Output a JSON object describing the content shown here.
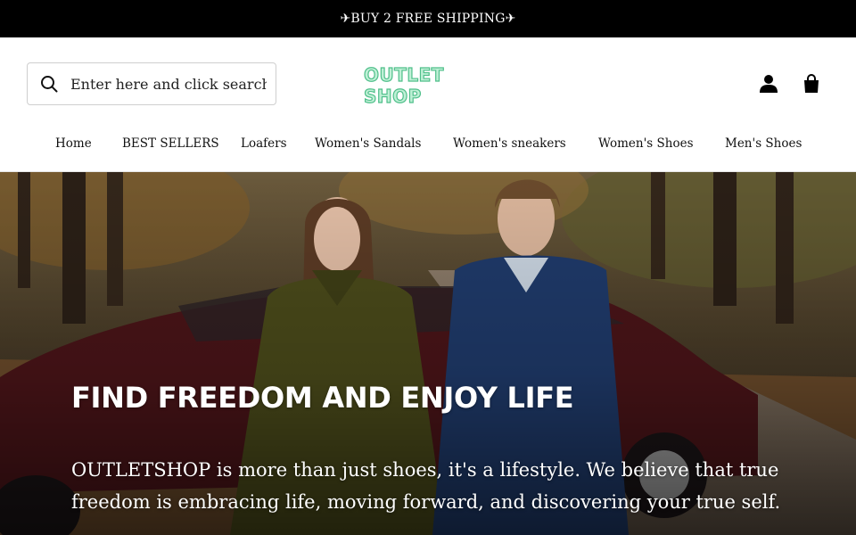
{
  "announcement": {
    "text": "✈BUY 2 FREE SHIPPING✈"
  },
  "search": {
    "placeholder": "Enter here and click search"
  },
  "logo": {
    "text": "OUTLET SHOP",
    "fill_color": "#bff0d6",
    "outline_color": "#4fbf8a"
  },
  "header_icons": {
    "account": "user-icon",
    "cart": "shopping-bag-icon"
  },
  "nav": {
    "items": [
      {
        "label": "Home"
      },
      {
        "label": "BEST SELLERS"
      },
      {
        "label": "Loafers"
      },
      {
        "label": "Women's Sandals"
      },
      {
        "label": "Women's sneakers"
      },
      {
        "label": "Women's Shoes"
      },
      {
        "label": "Men's Shoes"
      }
    ]
  },
  "hero": {
    "title": "FIND FREEDOM AND ENJOY LIFE",
    "body": "OUTLETSHOP is more than just shoes, it's a lifestyle. We believe that true freedom is embracing life, moving forward, and discovering your true self."
  },
  "colors": {
    "announcement_bg": "#000000",
    "text": "#111111",
    "hero_text": "#ffffff"
  }
}
